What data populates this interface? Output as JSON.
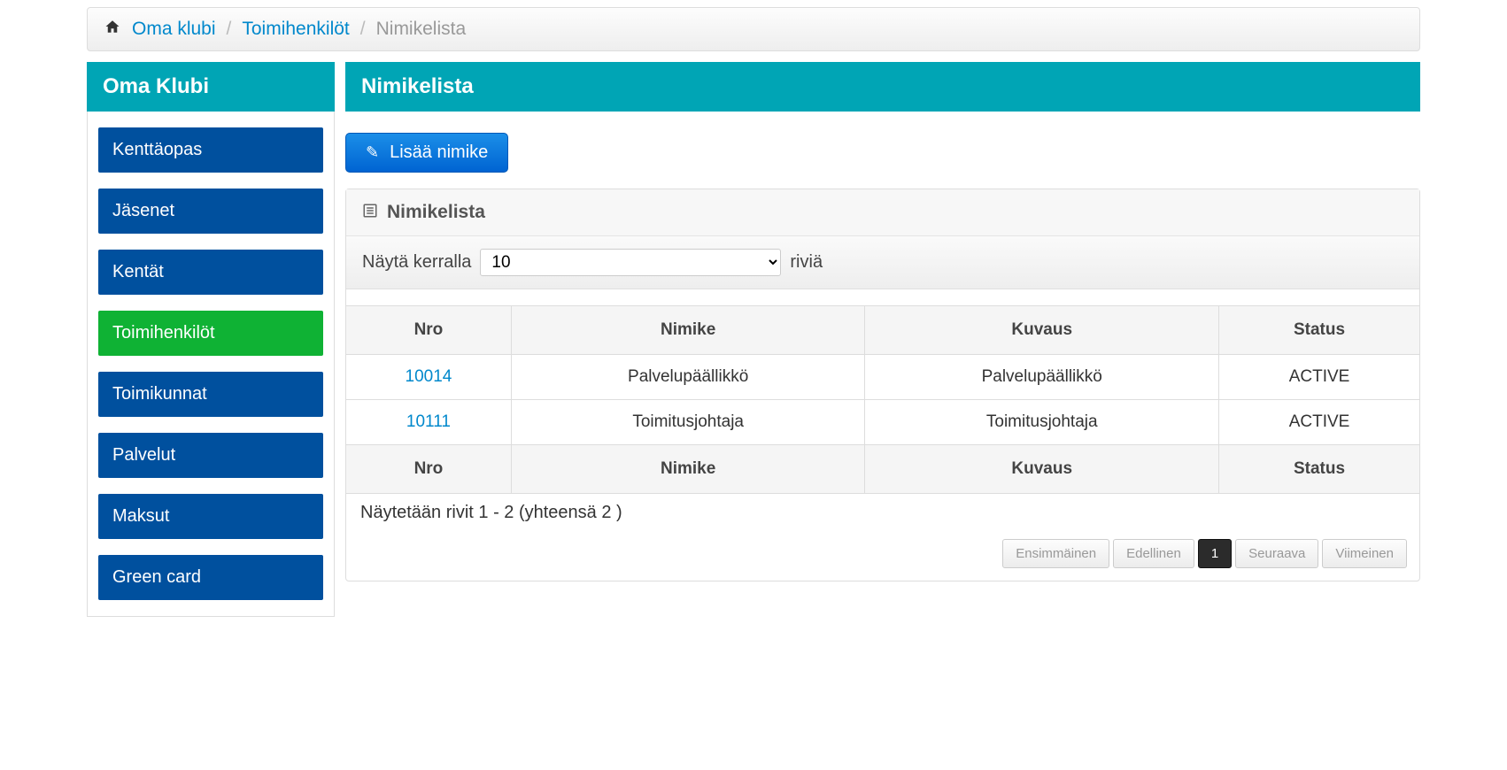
{
  "breadcrumb": {
    "home": "Oma klubi",
    "section": "Toimihenkilöt",
    "current": "Nimikelista"
  },
  "sidebar": {
    "title": "Oma Klubi",
    "items": [
      {
        "label": "Kenttäopas",
        "active": false
      },
      {
        "label": "Jäsenet",
        "active": false
      },
      {
        "label": "Kentät",
        "active": false
      },
      {
        "label": "Toimihenkilöt",
        "active": true
      },
      {
        "label": "Toimikunnat",
        "active": false
      },
      {
        "label": "Palvelut",
        "active": false
      },
      {
        "label": "Maksut",
        "active": false
      },
      {
        "label": "Green card",
        "active": false
      }
    ]
  },
  "main": {
    "title": "Nimikelista",
    "add_button": "Lisää nimike",
    "panel_title": "Nimikelista",
    "length": {
      "prefix": "Näytä kerralla",
      "value": "10",
      "suffix": "riviä"
    },
    "columns": {
      "nro": "Nro",
      "nimike": "Nimike",
      "kuvaus": "Kuvaus",
      "status": "Status"
    },
    "rows": [
      {
        "nro": "10014",
        "nimike": "Palvelupäällikkö",
        "kuvaus": "Palvelupäällikkö",
        "status": "ACTIVE"
      },
      {
        "nro": "10111",
        "nimike": "Toimitusjohtaja",
        "kuvaus": "Toimitusjohtaja",
        "status": "ACTIVE"
      }
    ],
    "info": "Näytetään rivit 1 - 2 (yhteensä 2 )",
    "pagination": {
      "first": "Ensimmäinen",
      "prev": "Edellinen",
      "current": "1",
      "next": "Seuraava",
      "last": "Viimeinen"
    }
  }
}
